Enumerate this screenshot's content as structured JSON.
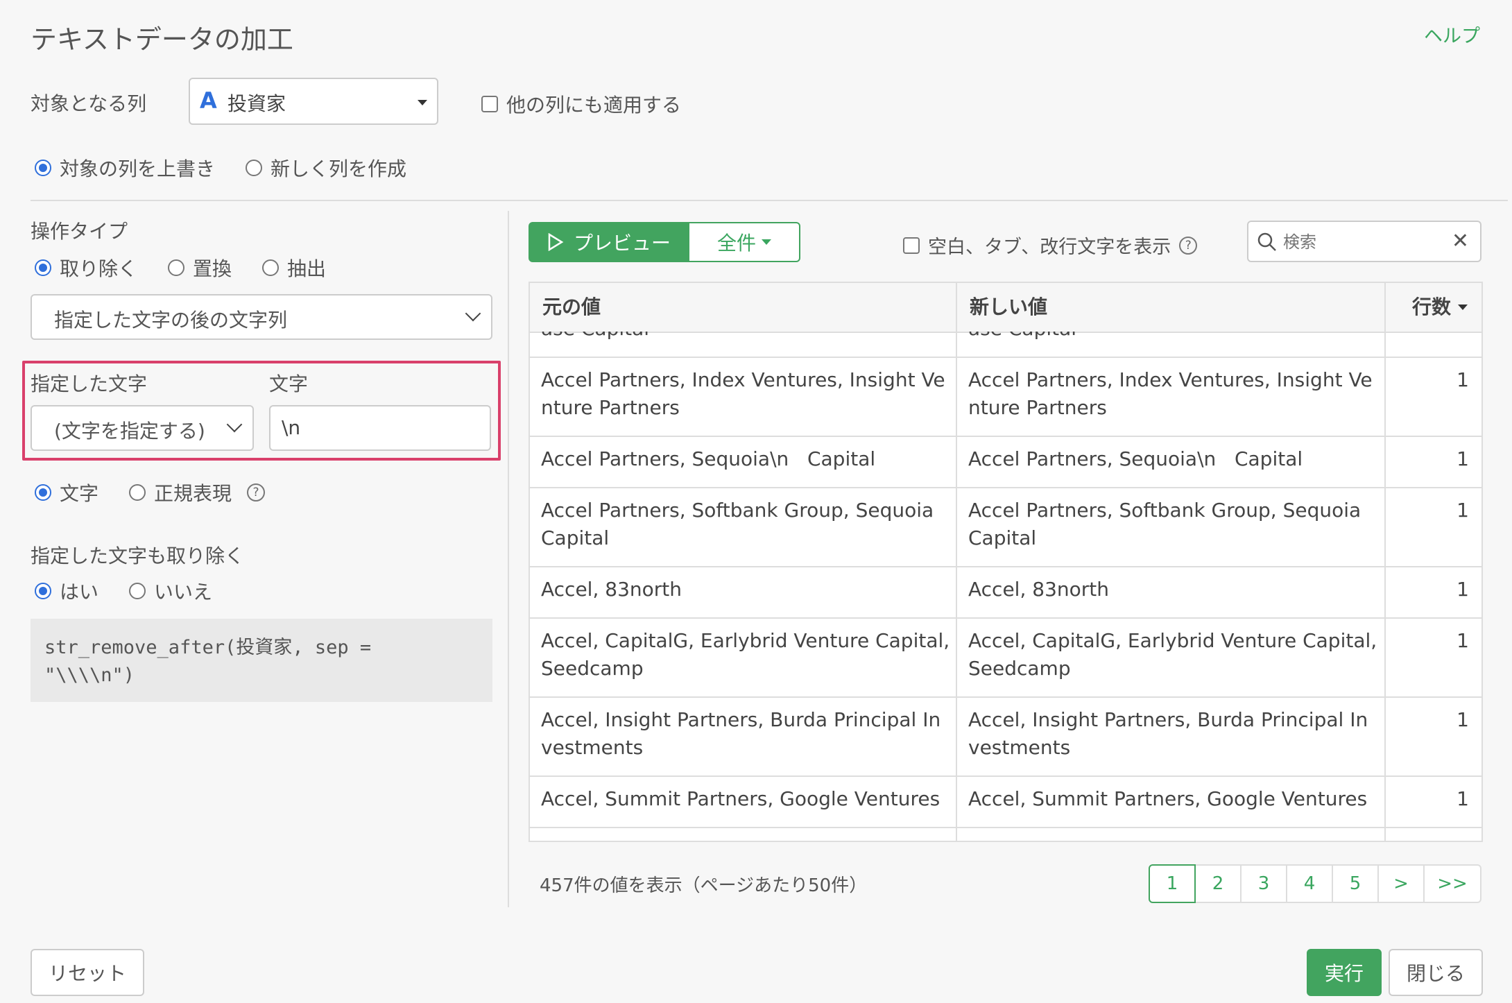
{
  "dialog": {
    "title": "テキストデータの加工",
    "help": "ヘルプ"
  },
  "target": {
    "label": "対象となる列",
    "column_type_icon": "A",
    "column_value": "投資家",
    "apply_other": "他の列にも適用する",
    "overwrite": "対象の列を上書き",
    "new_column": "新しく列を作成"
  },
  "operation": {
    "label": "操作タイプ",
    "remove": "取り除く",
    "replace": "置換",
    "extract": "抽出",
    "mode_select": "指定した文字の後の文字列",
    "spec_char_label": "指定した文字",
    "spec_char_select": "(文字を指定する)",
    "char_label": "文字",
    "char_value": "\\n",
    "literal": "文字",
    "regex": "正規表現",
    "include_label": "指定した文字も取り除く",
    "yes": "はい",
    "no": "いいえ",
    "code_line1": "str_remove_after(投資家, sep =",
    "code_line2": "\"\\\\\\\\n\")"
  },
  "preview": {
    "preview_btn": "プレビュー",
    "all_btn": "全件",
    "show_whitespace": "空白、タブ、改行文字を表示",
    "search_placeholder": "検索"
  },
  "table": {
    "headers": [
      "元の値",
      "新しい値",
      "行数"
    ],
    "partial_top": [
      "ase Capital",
      "ase Capital"
    ],
    "rows": [
      [
        "Accel Partners, Index Ventures, Insight Venture Partners",
        "Accel Partners, Index Ventures, Insight Venture Partners",
        "1"
      ],
      [
        "Accel Partners, Sequoia\\n   Capital",
        "Accel Partners, Sequoia\\n   Capital",
        "1"
      ],
      [
        "Accel Partners, Softbank Group, Sequoia Capital",
        "Accel Partners, Softbank Group, Sequoia Capital",
        "1"
      ],
      [
        "Accel, 83north",
        "Accel, 83north",
        "1"
      ],
      [
        "Accel, CapitalG, Earlybrid Venture Capital, Seedcamp",
        "Accel, CapitalG, Earlybrid Venture Capital, Seedcamp",
        "1"
      ],
      [
        "Accel, Insight Partners, Burda Principal Investments",
        "Accel, Insight Partners, Burda Principal Investments",
        "1"
      ],
      [
        "Accel, Summit Partners, Google Ventures",
        "Accel, Summit Partners, Google Ventures",
        "1"
      ]
    ]
  },
  "footer": {
    "summary": "457件の値を表示（ページあたり50件）",
    "pages": [
      "1",
      "2",
      "3",
      "4",
      "5",
      ">",
      ">>"
    ],
    "reset": "リセット",
    "run": "実行",
    "close": "閉じる"
  },
  "colors": {
    "accent_green": "#42a45f",
    "highlight_border": "#d9406b",
    "radio_blue": "#2f6fdb"
  }
}
